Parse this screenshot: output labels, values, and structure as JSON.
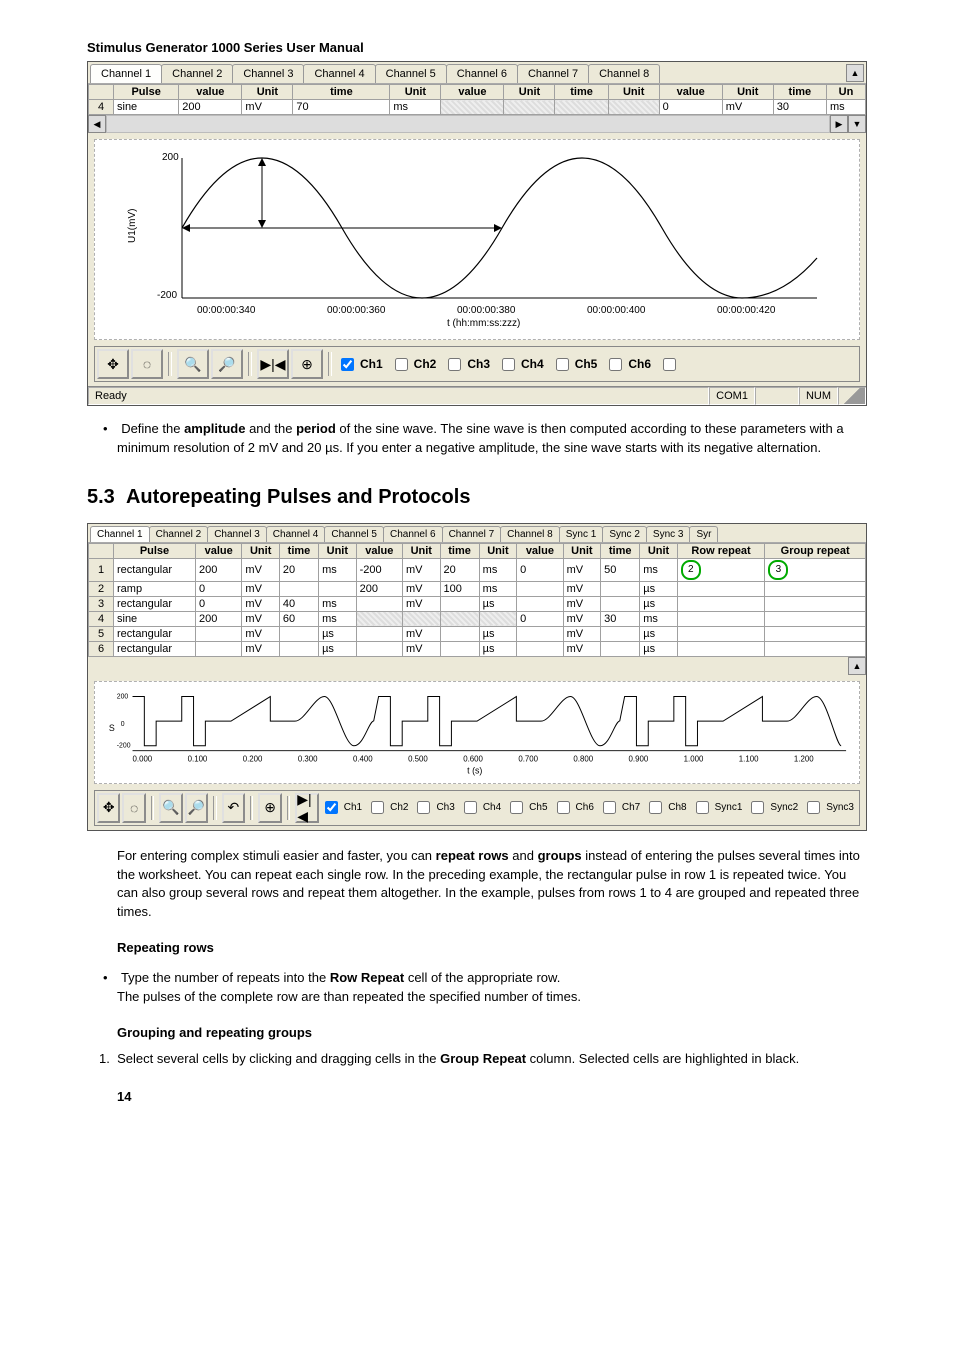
{
  "header": {
    "title": "Stimulus Generator 1000 Series User Manual"
  },
  "scr1": {
    "tabs": [
      "Channel 1",
      "Channel 2",
      "Channel 3",
      "Channel 4",
      "Channel 5",
      "Channel 6",
      "Channel 7",
      "Channel 8"
    ],
    "cols": [
      "Pulse",
      "value",
      "Unit",
      "time",
      "Unit",
      "value",
      "Unit",
      "time",
      "Unit",
      "value",
      "Unit",
      "time",
      "Un"
    ],
    "row_index": "4",
    "row": {
      "pulse": "sine",
      "v1": "200",
      "u1": "mV",
      "t1": "70",
      "u2": "ms",
      "v2": "",
      "u3": "",
      "t2": "",
      "u4": "",
      "v3": "0",
      "u5": "mV",
      "t3": "30",
      "u6": "ms"
    },
    "yaxis_label": "U1(mV)",
    "y_top": "200",
    "y_bottom": "-200",
    "xaxis_label": "t (hh:mm:ss:zzz)",
    "xticks": [
      "00:00:00:340",
      "00:00:00:360",
      "00:00:00:380",
      "00:00:00:400",
      "00:00:00:420"
    ],
    "toolbar_icons": [
      "pan-icon",
      "zoom-box-icon",
      "zoom-out-icon",
      "zoom-in-icon",
      "skip-icon",
      "zoom-fit-icon"
    ],
    "ch_checks": [
      "Ch1",
      "Ch2",
      "Ch3",
      "Ch4",
      "Ch5",
      "Ch6"
    ],
    "status_left": "Ready",
    "status_com": "COM1",
    "status_num": "NUM"
  },
  "para1_a": "Define the ",
  "para1_b": "amplitude",
  "para1_c": " and the ",
  "para1_d": "period",
  "para1_e": " of the sine wave. The sine wave is then computed according to these parameters with a minimum resolution of 2 mV and 20 µs. If you enter a negative amplitude, the sine wave starts with its negative alternation.",
  "section": {
    "num": "5.3",
    "title": "Autorepeating Pulses and Protocols"
  },
  "scr2": {
    "tabs": [
      "Channel 1",
      "Channel 2",
      "Channel 3",
      "Channel 4",
      "Channel 5",
      "Channel 6",
      "Channel 7",
      "Channel 8",
      "Sync 1",
      "Sync 2",
      "Sync 3",
      "Syr"
    ],
    "cols": [
      "Pulse",
      "value",
      "Unit",
      "time",
      "Unit",
      "value",
      "Unit",
      "time",
      "Unit",
      "value",
      "Unit",
      "time",
      "Unit",
      "Row repeat",
      "Group repeat"
    ],
    "rows": [
      {
        "i": "1",
        "pulse": "rectangular",
        "v1": "200",
        "u1": "mV",
        "t1": "20",
        "u2": "ms",
        "v2": "-200",
        "u3": "mV",
        "t2": "20",
        "u4": "ms",
        "v3": "0",
        "u5": "mV",
        "t3": "50",
        "u6": "ms",
        "rr": "2",
        "gr": "3"
      },
      {
        "i": "2",
        "pulse": "ramp",
        "v1": "0",
        "u1": "mV",
        "t1": "",
        "u2": "",
        "v2": "200",
        "u3": "mV",
        "t2": "100",
        "u4": "ms",
        "v3": "",
        "u5": "mV",
        "t3": "",
        "u6": "µs",
        "rr": "",
        "gr": ""
      },
      {
        "i": "3",
        "pulse": "rectangular",
        "v1": "0",
        "u1": "mV",
        "t1": "40",
        "u2": "ms",
        "v2": "",
        "u3": "mV",
        "t2": "",
        "u4": "µs",
        "v3": "",
        "u5": "mV",
        "t3": "",
        "u6": "µs",
        "rr": "",
        "gr": ""
      },
      {
        "i": "4",
        "pulse": "sine",
        "v1": "200",
        "u1": "mV",
        "t1": "60",
        "u2": "ms",
        "v2": "",
        "u3": "",
        "t2": "",
        "u4": "",
        "v3": "0",
        "u5": "mV",
        "t3": "30",
        "u6": "ms",
        "rr": "",
        "gr": ""
      },
      {
        "i": "5",
        "pulse": "rectangular",
        "v1": "",
        "u1": "mV",
        "t1": "",
        "u2": "µs",
        "v2": "",
        "u3": "mV",
        "t2": "",
        "u4": "µs",
        "v3": "",
        "u5": "mV",
        "t3": "",
        "u6": "µs",
        "rr": "",
        "gr": ""
      },
      {
        "i": "6",
        "pulse": "rectangular",
        "v1": "",
        "u1": "mV",
        "t1": "",
        "u2": "µs",
        "v2": "",
        "u3": "mV",
        "t2": "",
        "u4": "µs",
        "v3": "",
        "u5": "mV",
        "t3": "",
        "u6": "µs",
        "rr": "",
        "gr": ""
      }
    ],
    "yaxis2_top": "200",
    "yaxis2_mid": "0",
    "yaxis2_bot": "-200",
    "yaxis2_label": "S",
    "xaxis2_label": "t (s)",
    "xticks2": [
      "0.000",
      "0.100",
      "0.200",
      "0.300",
      "0.400",
      "0.500",
      "0.600",
      "0.700",
      "0.800",
      "0.900",
      "1.000",
      "1.100",
      "1.200"
    ],
    "ch_checks": [
      "Ch1",
      "Ch2",
      "Ch3",
      "Ch4",
      "Ch5",
      "Ch6",
      "Ch7",
      "Ch8",
      "Sync1",
      "Sync2",
      "Sync3"
    ]
  },
  "para2_a": "For entering complex stimuli easier and faster, you can ",
  "para2_b": "repeat rows",
  "para2_c": " and ",
  "para2_d": "groups",
  "para2_e": " instead of entering the pulses several times into the worksheet. You can repeat each single row. In the preceding example, the rectangular pulse in row 1 is repeated twice. You can also group several rows and repeat them altogether. In the example, pulses from rows 1 to 4 are grouped and repeated three times.",
  "sub1": "Repeating rows",
  "rr_a": "Type the number of repeats into the ",
  "rr_b": "Row Repeat",
  "rr_c": " cell of the appropriate row.",
  "rr_d": "The pulses of the complete row are than repeated the specified number of times.",
  "sub2": "Grouping and repeating groups",
  "gr_a": "Select several cells by clicking and dragging cells in the ",
  "gr_b": "Group Repeat",
  "gr_c": " column. Selected cells are highlighted in black.",
  "page_number": "14",
  "chart_data": [
    {
      "type": "line",
      "title": "Sine preview",
      "series": [
        {
          "name": "U1(mV)",
          "x": [
            340,
            350,
            360,
            370,
            380,
            390,
            400,
            410,
            420,
            430
          ],
          "y": [
            0,
            100,
            200,
            100,
            0,
            -100,
            -200,
            -100,
            0,
            100
          ]
        }
      ],
      "xlabel": "t (hh:mm:ss:zzz)",
      "ylabel": "U1(mV)",
      "ylim": [
        -200,
        200
      ],
      "xlim": [
        340,
        430
      ]
    },
    {
      "type": "line",
      "title": "Protocol preview",
      "series": [
        {
          "name": "S",
          "x": [
            0,
            0.02,
            0.02,
            0.04,
            0.04,
            0.09,
            0.09,
            0.11,
            0.11,
            0.13,
            0.13,
            0.18,
            0.18,
            0.28,
            0.28,
            0.32,
            0.32,
            0.38,
            0.41,
            0.44
          ],
          "y": [
            200,
            200,
            -200,
            -200,
            0,
            0,
            200,
            200,
            -200,
            -200,
            0,
            0,
            0,
            200,
            0,
            0,
            0,
            200,
            -200,
            0
          ]
        }
      ],
      "xlabel": "t (s)",
      "ylabel": "S",
      "ylim": [
        -200,
        200
      ],
      "xlim": [
        0,
        1.3
      ]
    }
  ]
}
